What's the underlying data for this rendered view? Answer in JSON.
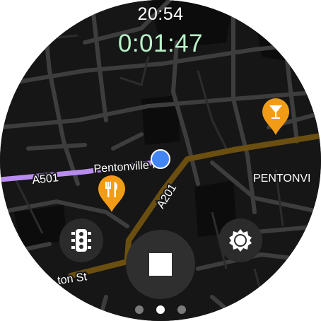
{
  "status": {
    "time": "20:54",
    "elapsed": "0:01:47"
  },
  "map": {
    "labels": {
      "road_a501": "A501",
      "road_pentonville": "Pentonville Rd",
      "road_a201": "A201",
      "area_pentonville": "PENTONVI",
      "street_bottom": "ton St"
    },
    "route_color": "#6b4f10",
    "highlight_road_color": "#b98cf0"
  },
  "pins": {
    "bar": {
      "icon": "cocktail-icon",
      "color": "#f29b16"
    },
    "restaurant": {
      "icon": "fork-knife-icon",
      "color": "#f29b16"
    }
  },
  "controls": {
    "traffic": {
      "icon": "traffic-light-icon"
    },
    "brightness": {
      "icon": "brightness-icon"
    },
    "stop": {
      "icon": "stop-icon"
    }
  },
  "pager": {
    "count": 3,
    "active_index": 1
  }
}
